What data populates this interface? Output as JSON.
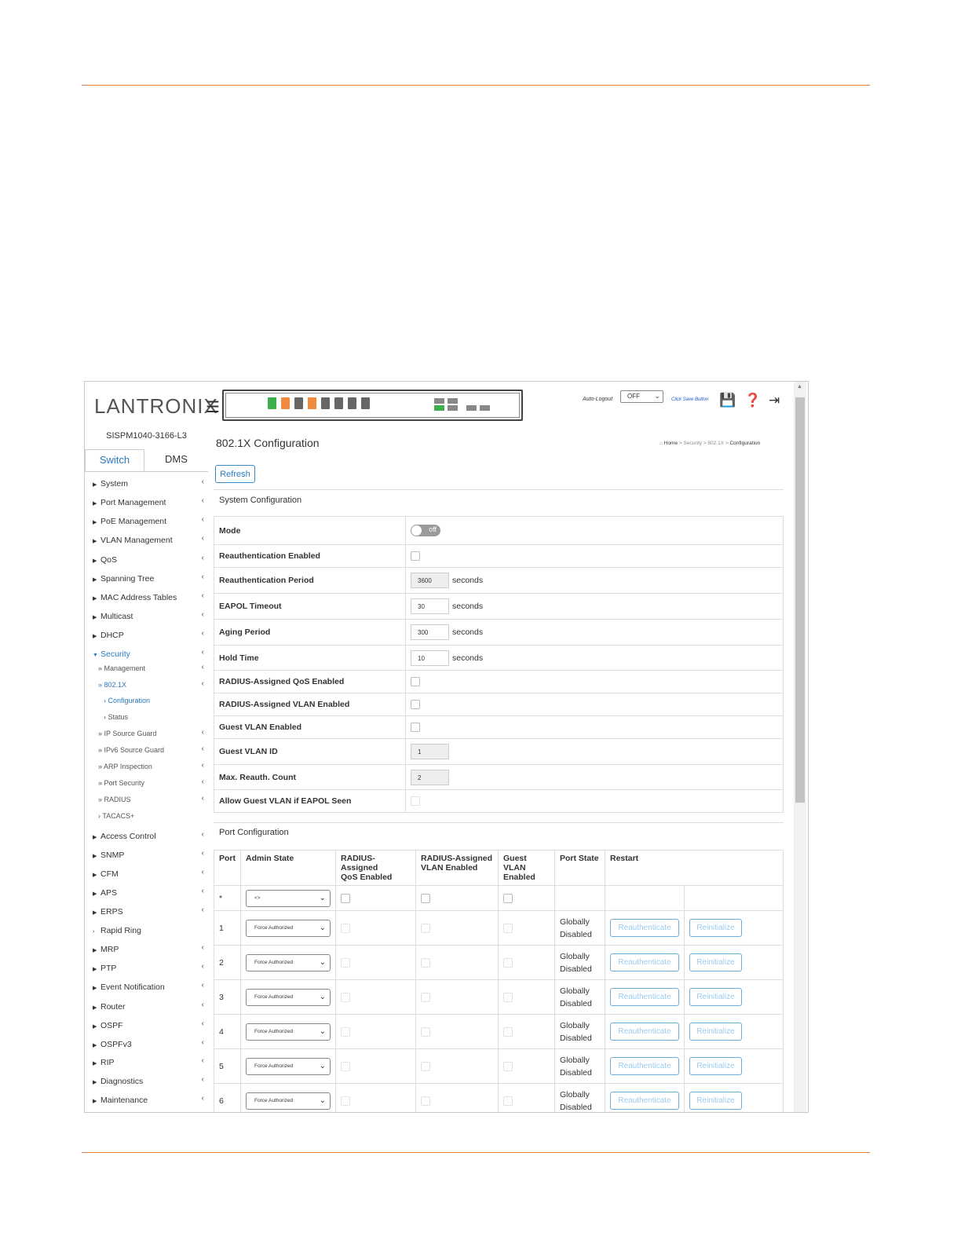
{
  "header": {
    "logo_text": "LANTRONIX",
    "auto_logout_label": "Auto-Logout",
    "auto_logout_value": "OFF",
    "click_save_label": "Click Save Button"
  },
  "sidebar": {
    "device_name": "SISPM1040-3166-L3",
    "tabs": [
      "Switch",
      "DMS"
    ],
    "items": [
      {
        "label": "System"
      },
      {
        "label": "Port Management"
      },
      {
        "label": "PoE Management"
      },
      {
        "label": "VLAN Management"
      },
      {
        "label": "QoS"
      },
      {
        "label": "Spanning Tree"
      },
      {
        "label": "MAC Address Tables"
      },
      {
        "label": "Multicast"
      },
      {
        "label": "DHCP"
      },
      {
        "label": "Security"
      },
      {
        "label": "Access Control"
      },
      {
        "label": "SNMP"
      },
      {
        "label": "CFM"
      },
      {
        "label": "APS"
      },
      {
        "label": "ERPS"
      },
      {
        "label": "Rapid Ring"
      },
      {
        "label": "MRP"
      },
      {
        "label": "PTP"
      },
      {
        "label": "Event Notification"
      },
      {
        "label": "Router"
      },
      {
        "label": "OSPF"
      },
      {
        "label": "OSPFv3"
      },
      {
        "label": "RIP"
      },
      {
        "label": "Diagnostics"
      },
      {
        "label": "Maintenance"
      }
    ],
    "security_sub": [
      "» Management",
      "» 802.1X",
      "» IP Source Guard",
      "» IPv6 Source Guard",
      "» ARP Inspection",
      "» Port Security",
      "» RADIUS",
      "› TACACS+"
    ],
    "dot1x_sub": [
      "› Configuration",
      "› Status"
    ]
  },
  "main": {
    "title": "802.1X Configuration",
    "breadcrumb": [
      "Home",
      "Security",
      "802.1X",
      "Configuration"
    ],
    "refresh_label": "Refresh",
    "system_section_title": "System Configuration",
    "system_rows": {
      "mode": "Mode",
      "mode_state": "off",
      "reauth_enabled": "Reauthentication Enabled",
      "reauth_period": "Reauthentication Period",
      "reauth_period_value": "3600",
      "eapol_timeout": "EAPOL Timeout",
      "eapol_timeout_value": "30",
      "aging_period": "Aging Period",
      "aging_period_value": "300",
      "hold_time": "Hold Time",
      "hold_time_value": "10",
      "radius_qos": "RADIUS-Assigned QoS Enabled",
      "radius_vlan": "RADIUS-Assigned VLAN Enabled",
      "guest_vlan_enabled": "Guest VLAN Enabled",
      "guest_vlan_id": "Guest VLAN ID",
      "guest_vlan_id_value": "1",
      "max_reauth": "Max. Reauth. Count",
      "max_reauth_value": "2",
      "allow_guest": "Allow Guest VLAN if EAPOL Seen",
      "unit": "seconds"
    },
    "port_section_title": "Port Configuration",
    "port_headers": {
      "port": "Port",
      "admin_state": "Admin State",
      "radius_qos_1": "RADIUS-Assigned",
      "radius_qos_2": "QoS Enabled",
      "radius_vlan_1": "RADIUS-Assigned",
      "radius_vlan_2": "VLAN Enabled",
      "guest_vlan_1": "Guest VLAN",
      "guest_vlan_2": "Enabled",
      "port_state": "Port State",
      "restart": "Restart"
    },
    "wildcard_row": {
      "port": "*",
      "admin_state": "<>"
    },
    "port_rows": [
      {
        "port": "1",
        "admin_state": "Force Authorized",
        "state_1": "Globally",
        "state_2": "Disabled"
      },
      {
        "port": "2",
        "admin_state": "Force Authorized",
        "state_1": "Globally",
        "state_2": "Disabled"
      },
      {
        "port": "3",
        "admin_state": "Force Authorized",
        "state_1": "Globally",
        "state_2": "Disabled"
      },
      {
        "port": "4",
        "admin_state": "Force Authorized",
        "state_1": "Globally",
        "state_2": "Disabled"
      },
      {
        "port": "5",
        "admin_state": "Force Authorized",
        "state_1": "Globally",
        "state_2": "Disabled"
      },
      {
        "port": "6",
        "admin_state": "Force Authorized",
        "state_1": "Globally",
        "state_2": "Disabled"
      }
    ],
    "reauthenticate_label": "Reauthenticate",
    "reinitialize_label": "Reinitialize"
  }
}
